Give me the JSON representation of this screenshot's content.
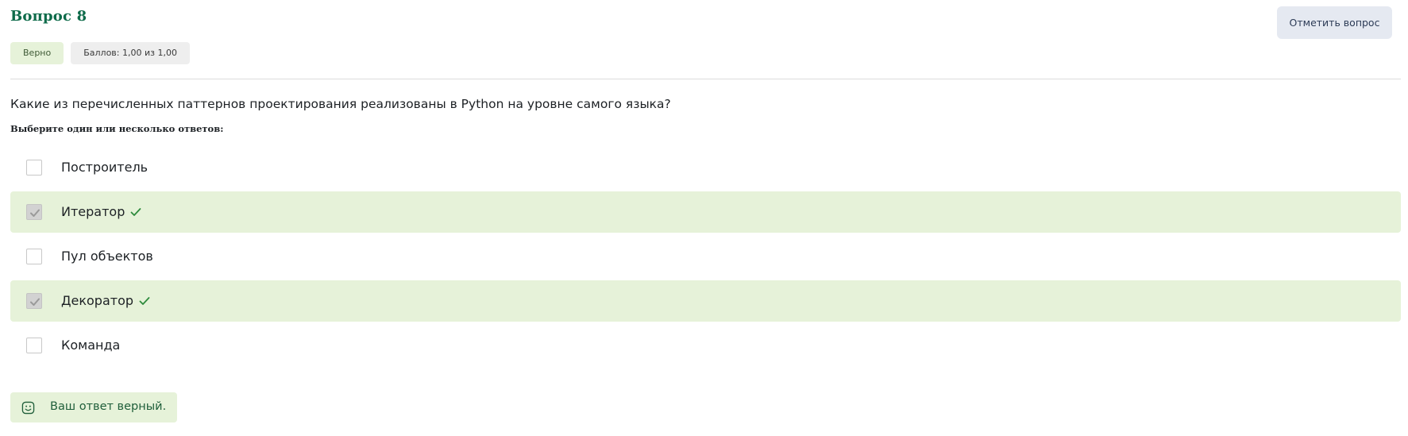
{
  "question": {
    "title": "Вопрос 8",
    "flag_button": "Отметить вопрос",
    "status_badge": "Верно",
    "grade_badge": "Баллов: 1,00 из 1,00",
    "text": "Какие из перечисленных паттернов проектирования реализованы в Python на уровне самого языка?",
    "prompt": "Выберите один или несколько ответов:"
  },
  "options": [
    {
      "label": "Построитель",
      "checked": false,
      "correct": false
    },
    {
      "label": "Итератор",
      "checked": true,
      "correct": true
    },
    {
      "label": "Пул объектов",
      "checked": false,
      "correct": false
    },
    {
      "label": "Декоратор",
      "checked": true,
      "correct": true
    },
    {
      "label": "Команда",
      "checked": false,
      "correct": false
    }
  ],
  "feedback": {
    "text": "Ваш ответ верный.",
    "icon": "smile-icon"
  },
  "colors": {
    "title": "#0e6b4a",
    "correct_bg": "#e6f2d9",
    "tick": "#2e8b3d",
    "flag_button_bg": "#e5e9f1"
  }
}
